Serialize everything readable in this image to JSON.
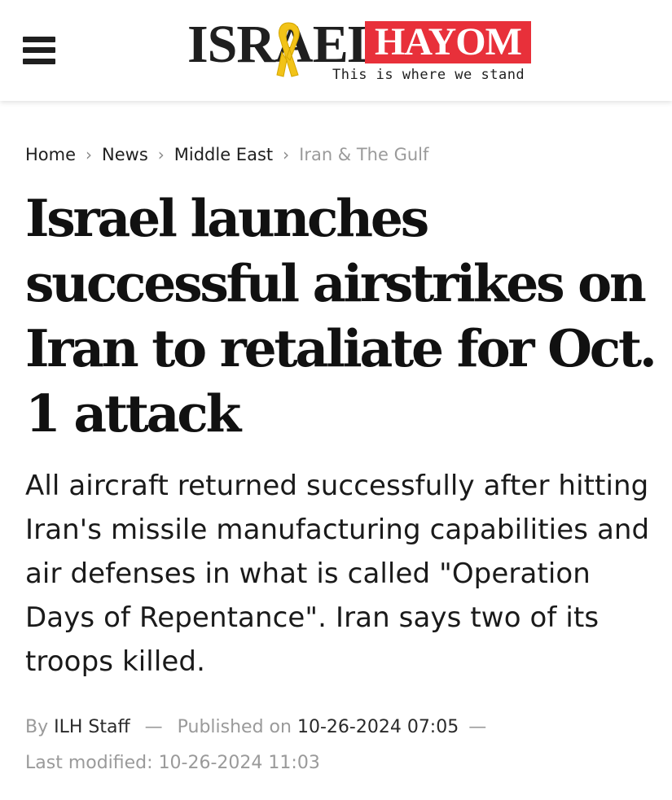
{
  "header": {
    "menu_icon": "hamburger-menu-icon",
    "logo": {
      "part1": "ISRAEL",
      "part2": "HAYOM",
      "tagline": "This is where we stand",
      "ribbon_icon": "yellow-ribbon-icon"
    },
    "colors": {
      "brand_red": "#e8303a",
      "ribbon_yellow": "#f2c318"
    }
  },
  "breadcrumb": {
    "items": [
      "Home",
      "News",
      "Middle East",
      "Iran & The Gulf"
    ],
    "separator_icon": "chevron-right-icon"
  },
  "article": {
    "title": "Israel launches successful airstrikes on Iran to retaliate for Oct. 1 attack",
    "subtitle": "All aircraft returned successfully after hitting Iran's missile manufacturing capabilities and air defenses in what is called \"Operation Days of Repentance\". Iran says two of its troops killed.",
    "byline": {
      "by_label": "By",
      "author": "ILH Staff",
      "dash": "—",
      "published_label": "Published on",
      "published": "10-26-2024 07:05",
      "modified_label": "Last modified:",
      "modified": "10-26-2024 11:03"
    }
  }
}
